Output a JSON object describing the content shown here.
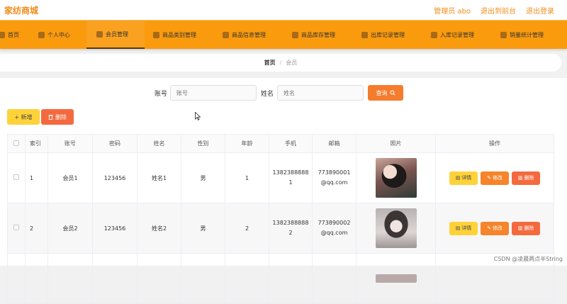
{
  "header": {
    "brand": "家纺商城",
    "admin_label": "管理员 abo",
    "front_link": "退出到前台",
    "logout_link": "退出登录"
  },
  "nav": {
    "items": [
      {
        "label": "首页",
        "icon": "home-icon"
      },
      {
        "label": "个人中心",
        "icon": "user-icon"
      },
      {
        "label": "会员管理",
        "icon": "member-icon"
      },
      {
        "label": "商品类别管理",
        "icon": "category-icon"
      },
      {
        "label": "商品信息管理",
        "icon": "goods-icon"
      },
      {
        "label": "商品库存管理",
        "icon": "stock-icon"
      },
      {
        "label": "出库记录管理",
        "icon": "out-icon"
      },
      {
        "label": "入库记录管理",
        "icon": "in-icon"
      },
      {
        "label": "销量统计管理",
        "icon": "stats-icon"
      }
    ],
    "active": "会员管理"
  },
  "breadcrumb": {
    "home": "首页",
    "sep": "/",
    "current": "会员"
  },
  "search": {
    "account_label": "账号",
    "account_placeholder": "账号",
    "name_label": "姓名",
    "name_placeholder": "姓名",
    "query_button": "查询"
  },
  "toolbar": {
    "add_label": "+ 新增",
    "delete_label": "删除"
  },
  "table": {
    "headers": [
      "索引",
      "账号",
      "密码",
      "姓名",
      "性别",
      "年龄",
      "手机",
      "邮箱",
      "照片",
      "操作"
    ],
    "rows": [
      {
        "index": "1",
        "account": "会员1",
        "password": "123456",
        "name": "姓名1",
        "gender": "男",
        "age": "1",
        "phone_a": "1382388888",
        "phone_b": "1",
        "email_a": "773890001",
        "email_b": "@qq.com"
      },
      {
        "index": "2",
        "account": "会员2",
        "password": "123456",
        "name": "姓名2",
        "gender": "男",
        "age": "2",
        "phone_a": "1382388888",
        "phone_b": "2",
        "email_a": "773890002",
        "email_b": "@qq.com"
      }
    ],
    "actions": {
      "detail": "详情",
      "edit": "修改",
      "delete": "删除"
    }
  },
  "watermark": "CSDN @凌晨两点半String",
  "colors": {
    "nav": "#fa9a0d",
    "brand": "#f08c1a",
    "query": "#f47c2c",
    "add": "#ffd23a",
    "delete": "#f46a3e"
  }
}
